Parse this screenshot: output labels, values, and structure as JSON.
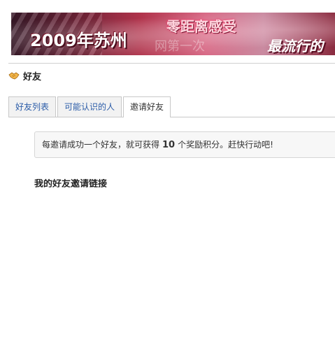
{
  "banner": {
    "year_text": "2009年苏州",
    "top_text": "零距离感受",
    "right_text": "最流行的",
    "ghost_text": "网第一次"
  },
  "page": {
    "title": "好友",
    "title_icon": "handshake-icon"
  },
  "tabs": [
    {
      "label": "好友列表",
      "active": false
    },
    {
      "label": "可能认识的人",
      "active": false
    },
    {
      "label": "邀请好友",
      "active": true
    }
  ],
  "notice": {
    "prefix": "每邀请成功一个好友，就可获得",
    "points": "10",
    "suffix": "个奖励积分。赶快行动吧!"
  },
  "section": {
    "heading": "我的好友邀请链接"
  },
  "colors": {
    "tab_link": "#2b5ca8",
    "notice_bg": "#f7f7f7",
    "banner_primary": "#b0334b"
  }
}
